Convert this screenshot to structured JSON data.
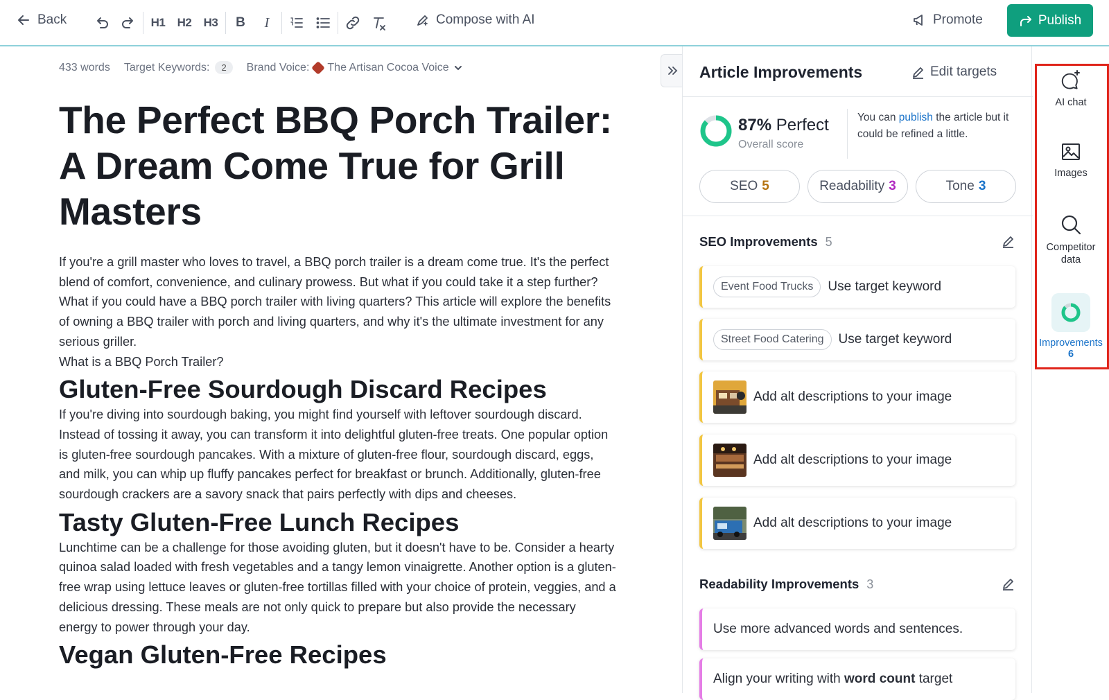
{
  "toolbar": {
    "back_label": "Back",
    "h1_label": "H1",
    "h2_label": "H2",
    "h3_label": "H3",
    "bold_label": "B",
    "italic_label": "I",
    "compose_label": "Compose with AI",
    "promote_label": "Promote",
    "publish_label": "Publish",
    "accent_color": "#0f9f7e"
  },
  "meta": {
    "word_count": "433 words",
    "target_keywords_label": "Target Keywords:",
    "target_keywords_count": "2",
    "brand_voice_label": "Brand Voice:",
    "brand_voice_value": "The Artisan Cocoa Voice"
  },
  "article": {
    "title": "The Perfect BBQ Porch Trailer: A Dream Come True for Grill Masters",
    "intro": "If you're a grill master who loves to travel, a BBQ porch trailer is a dream come true. It's the perfect blend of comfort, convenience, and culinary prowess. But what if you could take it a step further? What if you could have a BBQ porch trailer with living quarters? This article will explore the benefits of owning a BBQ trailer with porch and living quarters, and why it's the ultimate investment for any serious griller.",
    "intro_question": "What is a BBQ Porch Trailer?",
    "h2_1": "Gluten-Free Sourdough Discard Recipes",
    "p_1": "If you're diving into sourdough baking, you might find yourself with leftover sourdough discard. Instead of tossing it away, you can transform it into delightful gluten-free treats. One popular option is gluten-free sourdough pancakes. With a mixture of gluten-free flour, sourdough discard, eggs, and milk, you can whip up fluffy pancakes perfect for breakfast or brunch. Additionally, gluten-free sourdough crackers are a savory snack that pairs perfectly with dips and cheeses.",
    "h2_2": "Tasty Gluten-Free Lunch Recipes",
    "p_2": "Lunchtime can be a challenge for those avoiding gluten, but it doesn't have to be. Consider a hearty quinoa salad loaded with fresh vegetables and a tangy lemon vinaigrette. Another option is a gluten-free wrap using lettuce leaves or gluten-free tortillas filled with your choice of protein, veggies, and a delicious dressing. These meals are not only quick to prepare but also provide the necessary energy to power through your day.",
    "h2_3": "Vegan Gluten-Free Recipes"
  },
  "panel": {
    "title": "Article Improvements",
    "edit_targets_label": "Edit targets",
    "score_value": "87%",
    "score_word": "Perfect",
    "score_fraction": 0.87,
    "score_sub": "Overall score",
    "score_msg_pre": "You can ",
    "score_msg_link": "publish",
    "score_msg_post": " the article but it could be refined a little.",
    "pills": [
      {
        "label": "SEO",
        "count": "5",
        "color": "#b5730f"
      },
      {
        "label": "Readability",
        "count": "3",
        "color": "#b02ac0"
      },
      {
        "label": "Tone",
        "count": "3",
        "color": "#1a73c9"
      }
    ],
    "seo_section": {
      "title": "SEO Improvements",
      "count": "5",
      "items": [
        {
          "tag": "Event Food Trucks",
          "text": "Use target keyword"
        },
        {
          "tag": "Street Food Catering",
          "text": "Use target keyword"
        },
        {
          "text": "Add alt descriptions to your image"
        },
        {
          "text": "Add alt descriptions to your image"
        },
        {
          "text": "Add alt descriptions to your image"
        }
      ]
    },
    "readability_section": {
      "title": "Readability Improvements",
      "count": "3",
      "items": [
        {
          "text": "Use more advanced words and sentences."
        },
        {
          "text_pre": "Align your writing with ",
          "text_bold": "word count",
          "text_post": " target"
        }
      ]
    }
  },
  "rail": {
    "ai_chat_label": "AI chat",
    "images_label": "Images",
    "competitor_label": "Competitor data",
    "improvements_label": "Improvements",
    "improvements_count": "6"
  }
}
